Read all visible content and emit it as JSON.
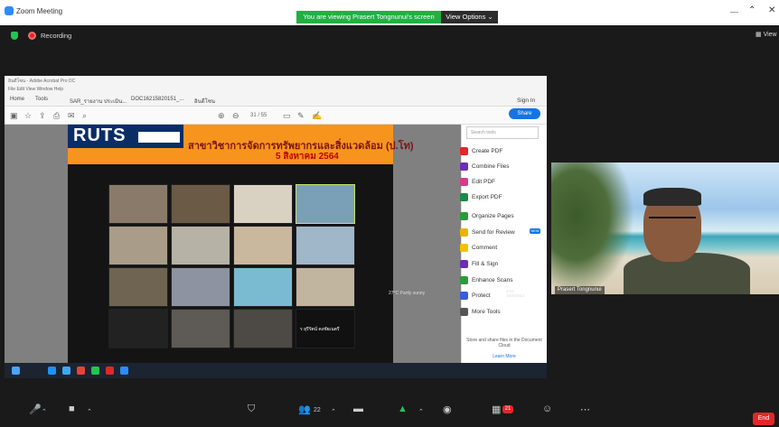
{
  "window": {
    "title": "Zoom Meeting"
  },
  "banner": {
    "text": "You are viewing Prasert Tongnunui's screen",
    "view_options": "View Options ⌄"
  },
  "recording": {
    "label": "Recording"
  },
  "view": {
    "label": "View"
  },
  "acrobat": {
    "titlebar": "อินดีโซน - Adobe Acrobat Pro DC",
    "menu": "File  Edit  View  Window  Help",
    "tabs": [
      "Home",
      "Tools",
      "SAR_รายงาน ประเมิน...",
      "DOC16215820151_...",
      "อินดีโซน"
    ],
    "page_indicator": "31 / 55",
    "sign_in": "Sign In",
    "share": "Share",
    "search_placeholder": "Search tools",
    "tools": [
      "Create PDF",
      "Combine Files",
      "Edit PDF",
      "Export PDF",
      "Organize Pages",
      "Send for Review",
      "Comment",
      "Fill & Sign",
      "Enhance Scans",
      "Protect",
      "More Tools"
    ],
    "new_badge": "NEW",
    "store_text": "Store and share files in the Document Cloud",
    "learn_more": "Learn More"
  },
  "slide": {
    "logo": "RUTS",
    "title": "สาขาวิชาการจัดการทรัพยากรและสิ่งแวดล้อม (ป.โท)",
    "date": "5 สิงหาคม 2564",
    "inner_caption": "ร ยุรีรัตน์ คงชัยเนตรี"
  },
  "taskbar": {
    "weather": "27°C Partly sunny",
    "time": "8:51",
    "date": "26/8/2564"
  },
  "speaker": {
    "name": "Prasert Tongnunui"
  },
  "controls": {
    "participants_count": "22",
    "chat_badge": "21",
    "end": "End"
  },
  "colors": {
    "accent": "#2d8cff",
    "banner_green": "#1fb141",
    "end_red": "#e02828",
    "slide_orange": "#f7941d"
  }
}
